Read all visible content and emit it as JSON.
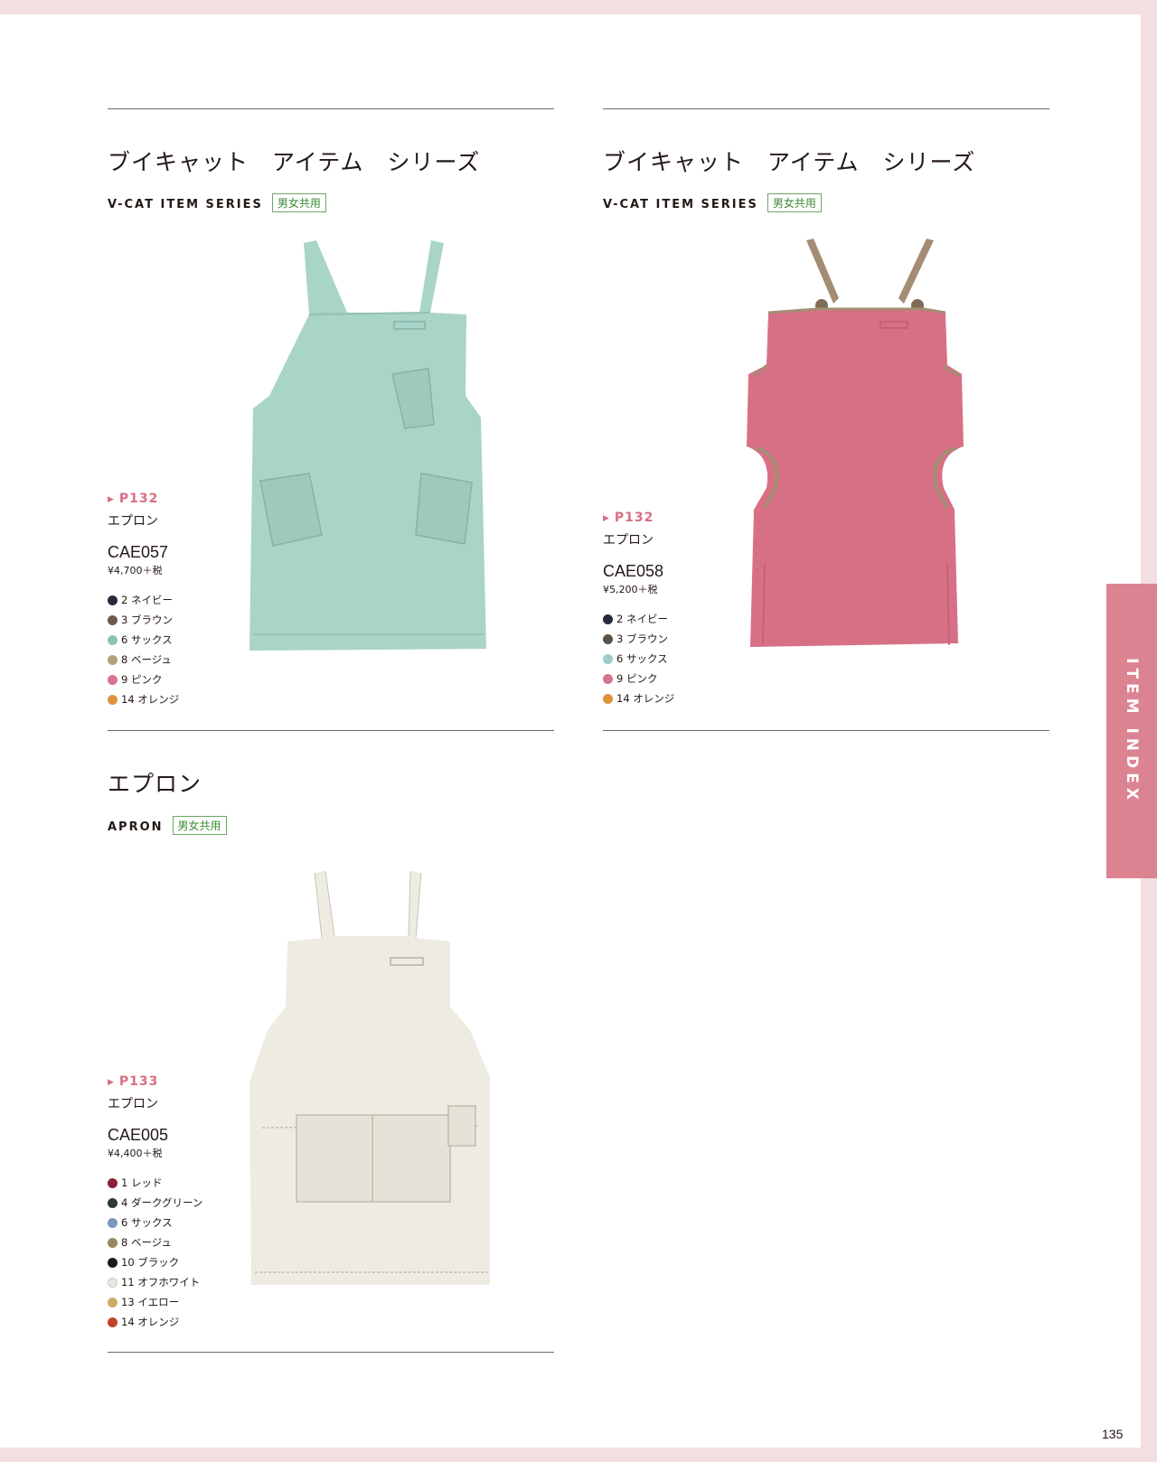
{
  "side_tab": "ITEM INDEX",
  "page_number": "135",
  "products": [
    {
      "title": "ブイキャット　アイテム　シリーズ",
      "subtitle": "V-CAT ITEM SERIES",
      "badge": "男女共用",
      "page_ref": "P132",
      "item_name": "エプロン",
      "code": "CAE057",
      "price": "¥4,700＋税",
      "image_icon": "apron-mint-icon",
      "colors": [
        {
          "label": "2 ネイビー",
          "hex": "#262a3b"
        },
        {
          "label": "3 ブラウン",
          "hex": "#6d5b4d"
        },
        {
          "label": "6 サックス",
          "hex": "#8cc2b6"
        },
        {
          "label": "8 ベージュ",
          "hex": "#b3a07b"
        },
        {
          "label": "9 ピンク",
          "hex": "#d7758a"
        },
        {
          "label": "14 オレンジ",
          "hex": "#de943d"
        }
      ]
    },
    {
      "title": "ブイキャット　アイテム　シリーズ",
      "subtitle": "V-CAT ITEM SERIES",
      "badge": "男女共用",
      "page_ref": "P132",
      "item_name": "エプロン",
      "code": "CAE058",
      "price": "¥5,200＋税",
      "image_icon": "apron-pink-icon",
      "colors": [
        {
          "label": "2 ネイビー",
          "hex": "#262a3b"
        },
        {
          "label": "3 ブラウン",
          "hex": "#5d5246"
        },
        {
          "label": "6 サックス",
          "hex": "#9bcdc9"
        },
        {
          "label": "9 ピンク",
          "hex": "#d7758a"
        },
        {
          "label": "14 オレンジ",
          "hex": "#de943d"
        }
      ]
    },
    {
      "title": "エプロン",
      "subtitle": "APRON",
      "badge": "男女共用",
      "page_ref": "P133",
      "item_name": "エプロン",
      "code": "CAE005",
      "price": "¥4,400＋税",
      "image_icon": "apron-offwhite-icon",
      "colors": [
        {
          "label": "1 レッド",
          "hex": "#8a2236"
        },
        {
          "label": "4 ダークグリーン",
          "hex": "#2e3a33"
        },
        {
          "label": "6 サックス",
          "hex": "#7f95bd"
        },
        {
          "label": "8 ベージュ",
          "hex": "#9a8760"
        },
        {
          "label": "10 ブラック",
          "hex": "#1c1c1c"
        },
        {
          "label": "11 オフホワイト",
          "hex": "#e8e6df"
        },
        {
          "label": "13 イエロー",
          "hex": "#cbab68"
        },
        {
          "label": "14 オレンジ",
          "hex": "#c1442b"
        }
      ]
    }
  ]
}
